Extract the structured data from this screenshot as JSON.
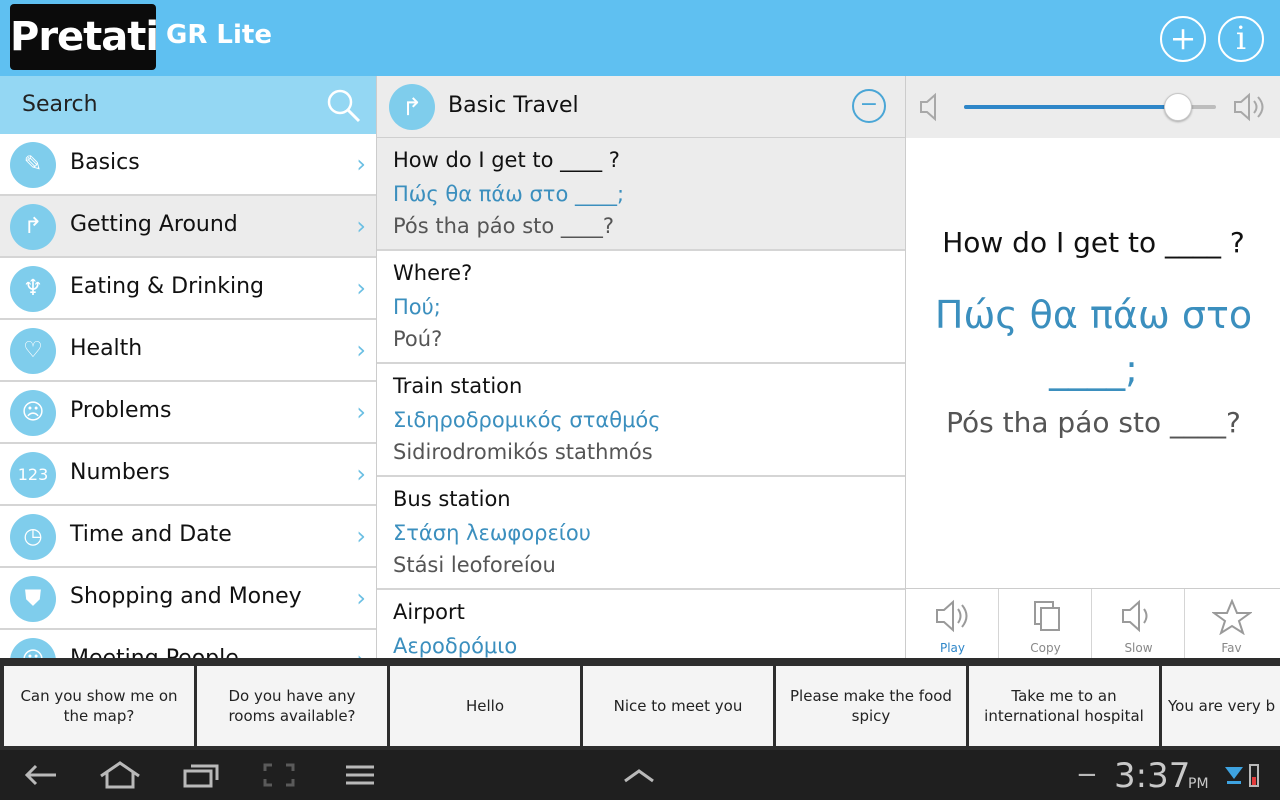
{
  "header": {
    "logo": "Pretati",
    "subtitle": "GR Lite",
    "add_icon": "plus-circle-icon",
    "info_icon": "info-circle-icon"
  },
  "search": {
    "label": "Search",
    "icon": "search-icon"
  },
  "categories": [
    {
      "label": "Basics",
      "icon": "pencil-icon"
    },
    {
      "label": "Getting Around",
      "icon": "arrow-turn-icon",
      "active": true
    },
    {
      "label": "Eating & Drinking",
      "icon": "food-icon"
    },
    {
      "label": "Health",
      "icon": "stethoscope-icon"
    },
    {
      "label": "Problems",
      "icon": "sad-face-icon"
    },
    {
      "label": "Numbers",
      "icon": "numbers-icon"
    },
    {
      "label": "Time and Date",
      "icon": "clock-calendar-icon"
    },
    {
      "label": "Shopping and Money",
      "icon": "shopping-bag-icon"
    },
    {
      "label": "Meeting People",
      "icon": "people-icon"
    }
  ],
  "section": {
    "title": "Basic Travel",
    "icon": "arrow-turn-icon",
    "collapse_icon": "minus-circle-icon"
  },
  "phrases": [
    {
      "en": "How do I get to ____ ?",
      "gr": "Πώς θα πάω στο ____;",
      "tr": "Pós tha páo sto ____?"
    },
    {
      "en": "Where?",
      "gr": "Πού;",
      "tr": "Poú?"
    },
    {
      "en": "Train station",
      "gr": "Σιδηροδρομικός σταθμός",
      "tr": "Sidirodromikós stathmós"
    },
    {
      "en": "Bus station",
      "gr": "Στάση λεωφορείου",
      "tr": "Stási leoforeíou"
    },
    {
      "en": "Airport",
      "gr": "Αεροδρόμιο",
      "tr": ""
    }
  ],
  "volume": {
    "level": 0.85,
    "mute_icon": "speaker-mute-icon",
    "loud_icon": "speaker-loud-icon"
  },
  "detail": {
    "en": "How do I get to ____ ?",
    "gr": "Πώς θα πάω στο ____;",
    "tr": "Pós tha páo sto ____?"
  },
  "actions": [
    {
      "label": "Play",
      "icon": "speaker-icon"
    },
    {
      "label": "Copy",
      "icon": "copy-icon"
    },
    {
      "label": "Slow",
      "icon": "speaker-slow-icon"
    },
    {
      "label": "Fav",
      "icon": "star-icon"
    }
  ],
  "quick_phrases": [
    "Can you show me on the map?",
    "Do you have any rooms available?",
    "Hello",
    "Nice to meet you",
    "Please make the food spicy",
    "Take me to an international hospital",
    "You are very b"
  ],
  "system": {
    "time": "3:37",
    "ampm": "PM"
  }
}
